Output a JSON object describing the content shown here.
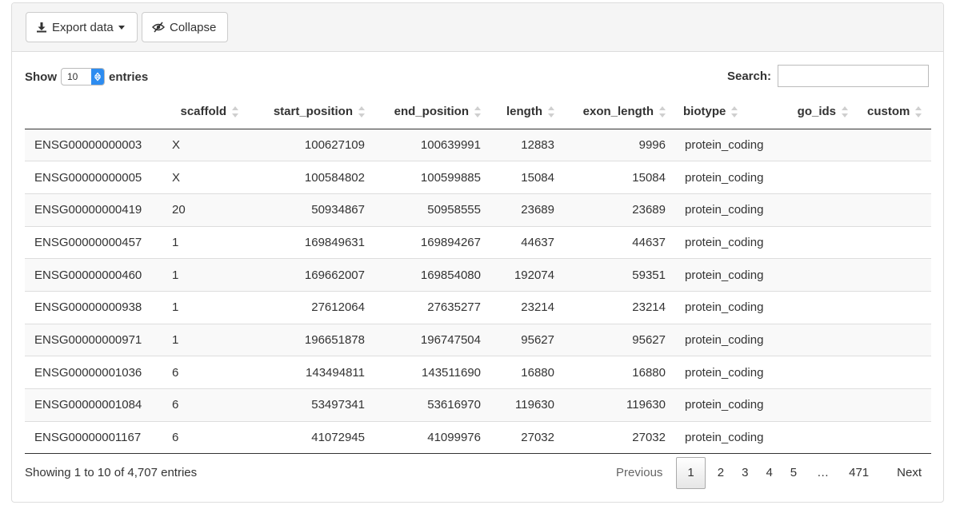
{
  "toolbar": {
    "export_label": "Export data",
    "collapse_label": "Collapse"
  },
  "controls": {
    "show_label": "Show",
    "page_length": "10",
    "entries_label": "entries",
    "search_label": "Search:",
    "search_value": ""
  },
  "table": {
    "columns": [
      "",
      "scaffold",
      "start_position",
      "end_position",
      "length",
      "exon_length",
      "biotype",
      "go_ids",
      "custom"
    ],
    "rows": [
      [
        "ENSG00000000003",
        "X",
        "100627109",
        "100639991",
        "12883",
        "9996",
        "protein_coding",
        "",
        ""
      ],
      [
        "ENSG00000000005",
        "X",
        "100584802",
        "100599885",
        "15084",
        "15084",
        "protein_coding",
        "",
        ""
      ],
      [
        "ENSG00000000419",
        "20",
        "50934867",
        "50958555",
        "23689",
        "23689",
        "protein_coding",
        "",
        ""
      ],
      [
        "ENSG00000000457",
        "1",
        "169849631",
        "169894267",
        "44637",
        "44637",
        "protein_coding",
        "",
        ""
      ],
      [
        "ENSG00000000460",
        "1",
        "169662007",
        "169854080",
        "192074",
        "59351",
        "protein_coding",
        "",
        ""
      ],
      [
        "ENSG00000000938",
        "1",
        "27612064",
        "27635277",
        "23214",
        "23214",
        "protein_coding",
        "",
        ""
      ],
      [
        "ENSG00000000971",
        "1",
        "196651878",
        "196747504",
        "95627",
        "95627",
        "protein_coding",
        "",
        ""
      ],
      [
        "ENSG00000001036",
        "6",
        "143494811",
        "143511690",
        "16880",
        "16880",
        "protein_coding",
        "",
        ""
      ],
      [
        "ENSG00000001084",
        "6",
        "53497341",
        "53616970",
        "119630",
        "119630",
        "protein_coding",
        "",
        ""
      ],
      [
        "ENSG00000001167",
        "6",
        "41072945",
        "41099976",
        "27032",
        "27032",
        "protein_coding",
        "",
        ""
      ]
    ]
  },
  "footer": {
    "info": "Showing 1 to 10 of 4,707 entries",
    "previous": "Previous",
    "pages": [
      "1",
      "2",
      "3",
      "4",
      "5"
    ],
    "ellipsis": "…",
    "last_page": "471",
    "next": "Next"
  },
  "colors": {
    "header_bg": "#f5f5f5",
    "stripe": "#f9f9f9",
    "select_accent": "#2d8cf0"
  },
  "icons": {
    "export": "download-icon",
    "collapse": "eye-slash-icon"
  }
}
